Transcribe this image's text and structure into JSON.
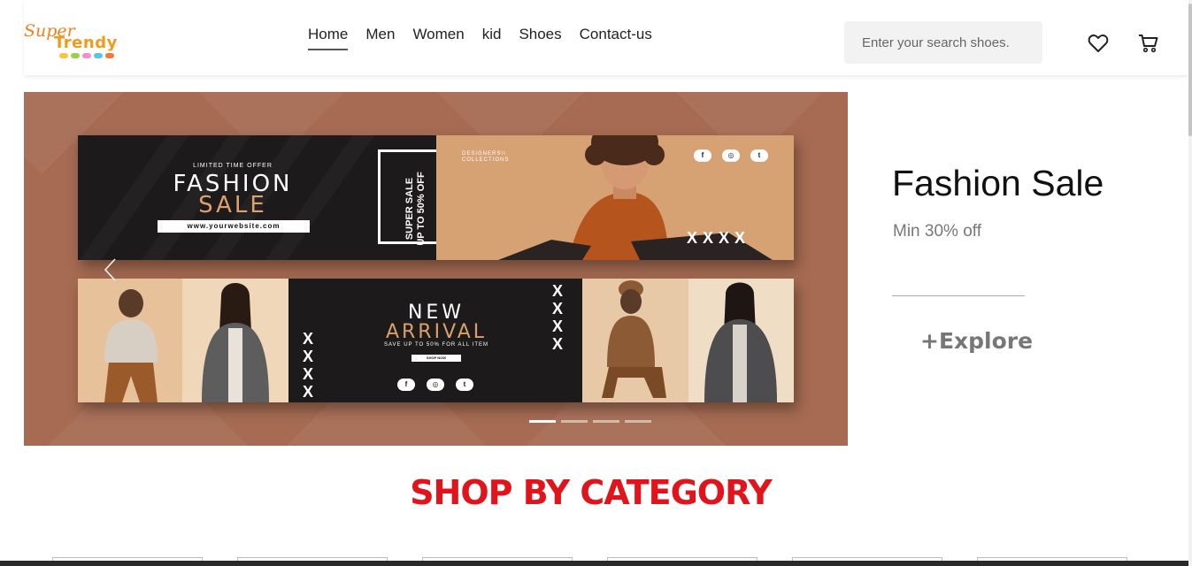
{
  "logo": {
    "word1": "Super",
    "word2": "Trendy"
  },
  "nav": {
    "items": [
      {
        "label": "Home",
        "active": true
      },
      {
        "label": "Men"
      },
      {
        "label": "Women"
      },
      {
        "label": "kid"
      },
      {
        "label": "Shoes"
      },
      {
        "label": "Contact-us"
      }
    ]
  },
  "search": {
    "placeholder": "Enter your search shoes."
  },
  "icons": {
    "wishlist": "heart-icon",
    "cart": "cart-icon",
    "prev": "chevron-left-icon"
  },
  "hero_banner": {
    "limited": "LIMITED TIME OFFER",
    "fashion": "FASHION",
    "sale": "SALE",
    "website": "www.yourwebsite.com",
    "super_sale_line1": "SUPER SALE",
    "super_sale_line2": "UP TO 50% OFF",
    "designers_line1": "DESIGNERS\\\\",
    "designers_line2": "COLLECTIONS",
    "new": "NEW",
    "arrival": "ARRIVAL",
    "save": "SAVE UP TO 50% FOR ALL ITEM",
    "shop_now": "SHOP NOW",
    "x_marks": "XXXX"
  },
  "carousel": {
    "slides": 4,
    "active_slide": 1
  },
  "hero_side": {
    "title": "Fashion Sale",
    "subtitle": "Min 30% off",
    "explore": "+Explore"
  },
  "category": {
    "title": "SHOP BY CATEGORY"
  },
  "colors": {
    "accent_red": "#e0141a",
    "hero_bg": "#a66b52",
    "logo_orange": "#f08020"
  }
}
